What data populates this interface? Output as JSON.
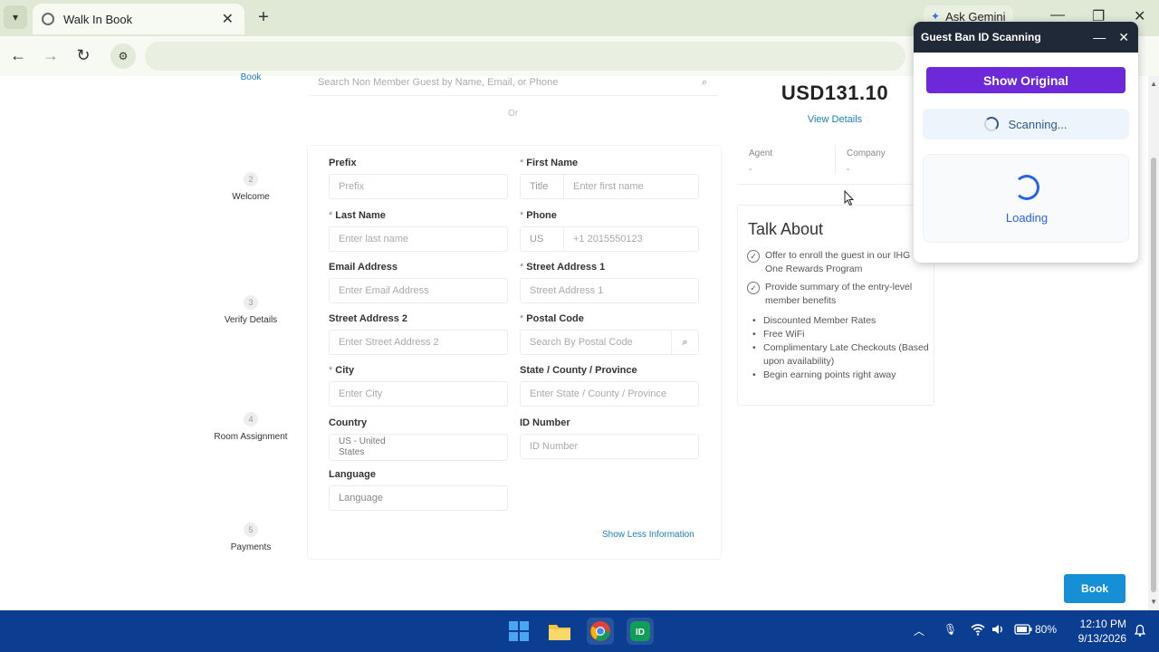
{
  "browser": {
    "tab_title": "Walk In Book",
    "gemini_label": "Ask Gemini",
    "new_tab": "+",
    "tab_close": "✕",
    "back": "←",
    "forward": "→",
    "reload": "↻",
    "minimize": "—",
    "restore": "❐",
    "close": "✕"
  },
  "steps": [
    {
      "num": "",
      "label": "Book"
    },
    {
      "num": "2",
      "label": "Welcome"
    },
    {
      "num": "3",
      "label": "Verify Details"
    },
    {
      "num": "4",
      "label": "Room Assignment"
    },
    {
      "num": "5",
      "label": "Payments"
    }
  ],
  "search": {
    "placeholder": "Search Non Member Guest by Name, Email, or Phone",
    "or_text": "Or"
  },
  "form": {
    "prefix": {
      "label": "Prefix",
      "placeholder": "Prefix"
    },
    "first_name": {
      "label": "First Name",
      "prefix": "Title",
      "placeholder": "Enter first name"
    },
    "last_name": {
      "label": "Last Name",
      "placeholder": "Enter last name"
    },
    "phone": {
      "label": "Phone",
      "prefix": "US",
      "placeholder": "+1 2015550123"
    },
    "email": {
      "label": "Email Address",
      "placeholder": "Enter Email Address"
    },
    "street1": {
      "label": "Street Address 1",
      "placeholder": "Street Address 1"
    },
    "street2": {
      "label": "Street Address 2",
      "placeholder": "Enter Street Address 2"
    },
    "postal": {
      "label": "Postal Code",
      "placeholder": "Search By Postal Code"
    },
    "city": {
      "label": "City",
      "placeholder": "Enter City"
    },
    "state": {
      "label": "State / County / Province",
      "placeholder": "Enter State / County / Province"
    },
    "country": {
      "label": "Country",
      "value_line1": "US - United",
      "value_line2": "States"
    },
    "id_number": {
      "label": "ID Number",
      "placeholder": "ID Number"
    },
    "language": {
      "label": "Language",
      "placeholder": "Language"
    },
    "required_mark": "*",
    "show_less": "Show Less Information"
  },
  "summary": {
    "price": "USD131.10",
    "view_details": "View Details",
    "agent_label": "Agent",
    "agent_value": "-",
    "company_label": "Company",
    "company_value": "-"
  },
  "talk_about": {
    "title": "Talk About",
    "checks": [
      "Offer to enroll the guest in our IHG One Rewards Program",
      "Provide summary of the entry-level member benefits"
    ],
    "bullets": [
      "Discounted Member Rates",
      "Free WiFi",
      "Complimentary Late Checkouts (Based upon availability)",
      "Begin earning points right away"
    ]
  },
  "book_button": "Book",
  "popup": {
    "title": "Guest Ban ID Scanning",
    "minimize": "—",
    "close": "✕",
    "show_original": "Show Original",
    "scanning": "Scanning...",
    "loading": "Loading"
  },
  "taskbar": {
    "battery": "80%",
    "time": "12:10 PM",
    "date": "9/13/2026",
    "tray_chevron": "︿"
  },
  "colors": {
    "primary_blue": "#1590d6",
    "popup_header": "#1f2937",
    "show_original_purple": "#6d28d9",
    "taskbar": "#0b3d91"
  },
  "icons": [
    "chevron-down-icon",
    "globe-icon",
    "close-icon",
    "plus-icon",
    "back-arrow-icon",
    "forward-arrow-icon",
    "reload-icon",
    "site-settings-icon",
    "search-icon",
    "checkmark-circle-icon",
    "spinner-icon",
    "windows-start-icon",
    "file-explorer-icon",
    "chrome-icon",
    "id-app-icon",
    "microphone-icon",
    "wifi-icon",
    "volume-icon",
    "battery-icon",
    "notification-icon"
  ]
}
